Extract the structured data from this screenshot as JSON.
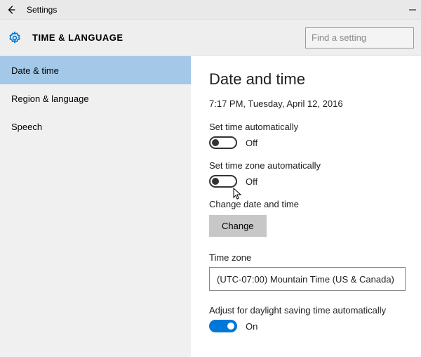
{
  "window": {
    "title": "Settings"
  },
  "header": {
    "category": "TIME & LANGUAGE",
    "search_placeholder": "Find a setting"
  },
  "sidebar": {
    "items": [
      {
        "label": "Date & time",
        "selected": true
      },
      {
        "label": "Region & language",
        "selected": false
      },
      {
        "label": "Speech",
        "selected": false
      }
    ]
  },
  "main": {
    "title": "Date and time",
    "current_datetime": "7:17 PM, Tuesday, April 12, 2016",
    "set_time_auto": {
      "label": "Set time automatically",
      "state": "Off",
      "on": false
    },
    "set_tz_auto": {
      "label": "Set time zone automatically",
      "state": "Off",
      "on": false
    },
    "change_section": {
      "label": "Change date and time",
      "button": "Change"
    },
    "timezone": {
      "label": "Time zone",
      "value": "(UTC-07:00) Mountain Time (US & Canada)"
    },
    "dst": {
      "label": "Adjust for daylight saving time automatically",
      "state": "On",
      "on": true
    }
  }
}
